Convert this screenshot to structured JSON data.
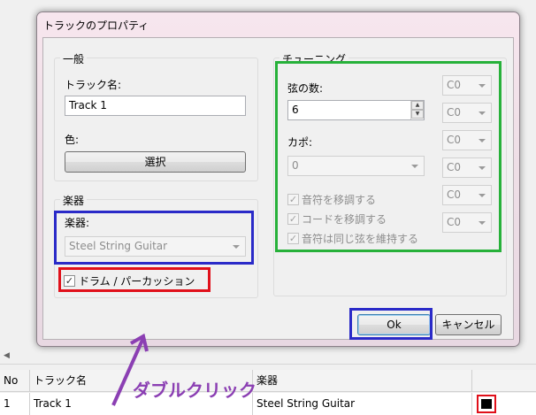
{
  "dialog": {
    "title": "トラックのプロパティ",
    "general": {
      "group_label": "一般",
      "track_name_label": "トラック名:",
      "track_name_value": "Track 1",
      "color_label": "色:",
      "select_button": "選択"
    },
    "instrument": {
      "group_label": "楽器",
      "instrument_label": "楽器:",
      "instrument_value": "Steel String Guitar",
      "drum_checkbox_label": "ドラム / パーカッション",
      "drum_checked": true
    },
    "tuning": {
      "group_label": "チューニング",
      "strings_label": "弦の数:",
      "strings_value": "6",
      "capo_label": "カポ:",
      "capo_value": "0",
      "transpose_notes": "音符を移調する",
      "transpose_chords": "コードを移調する",
      "keep_strings": "音符は同じ弦を維持する",
      "string_notes": [
        "C0",
        "C0",
        "C0",
        "C0",
        "C0",
        "C0"
      ]
    },
    "ok_button": "Ok",
    "cancel_button": "キャンセル"
  },
  "table": {
    "headers": [
      "No",
      "トラック名",
      "楽器"
    ],
    "rows": [
      {
        "no": "1",
        "name": "Track 1",
        "instrument": "Steel String Guitar"
      }
    ]
  },
  "annotation": {
    "text": "ダブルクリック",
    "color": "#8b3fb3"
  },
  "highlight_colors": {
    "blue": "#2a2ac8",
    "red": "#e0101a",
    "green": "#27b13a"
  }
}
